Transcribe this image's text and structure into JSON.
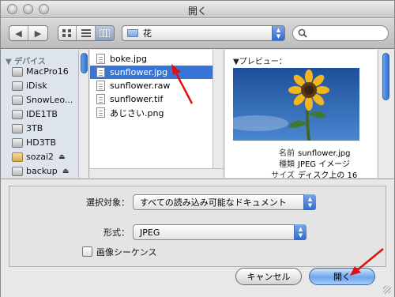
{
  "window": {
    "title": "開く"
  },
  "toolbar": {
    "back_glyph": "◀",
    "forward_glyph": "▶",
    "view_icons": [
      "icon-view-icon",
      "list-view-icon",
      "column-view-icon"
    ],
    "location": "花",
    "search_value": ""
  },
  "sidebar": {
    "header": "デバイス",
    "items": [
      {
        "label": "MacPro16",
        "icon": "drive-icon",
        "eject": false
      },
      {
        "label": "iDisk",
        "icon": "drive-icon",
        "eject": false
      },
      {
        "label": "SnowLeo...",
        "icon": "drive-icon",
        "eject": false
      },
      {
        "label": "IDE1TB",
        "icon": "drive-icon",
        "eject": false
      },
      {
        "label": "3TB",
        "icon": "drive-icon",
        "eject": false
      },
      {
        "label": "HD3TB",
        "icon": "drive-icon",
        "eject": false
      },
      {
        "label": "sozai2",
        "icon": "folder-icon",
        "eject": true
      },
      {
        "label": "backup",
        "icon": "drive-icon",
        "eject": true
      }
    ]
  },
  "files": [
    {
      "name": "boke.jpg",
      "selected": false
    },
    {
      "name": "sunflower.jpg",
      "selected": true
    },
    {
      "name": "sunflower.raw",
      "selected": false
    },
    {
      "name": "sunflower.tif",
      "selected": false
    },
    {
      "name": "あじさい.png",
      "selected": false
    }
  ],
  "preview": {
    "header": "▼プレビュー：",
    "info": [
      {
        "key": "名前",
        "value": "sunflower.jpg"
      },
      {
        "key": "種類",
        "value": "JPEG イメージ"
      },
      {
        "key": "サイズ",
        "value": "ディスク上の 16"
      }
    ]
  },
  "options": {
    "enable_label": "選択対象：",
    "enable_value": "すべての読み込み可能なドキュメント",
    "format_label": "形式：",
    "format_value": "JPEG",
    "image_sequence_label": "画像シーケンス",
    "image_sequence_checked": false
  },
  "buttons": {
    "cancel": "キャンセル",
    "open": "開く"
  },
  "colors": {
    "selection": "#3875d7",
    "annotation_arrow": "#e01010"
  }
}
